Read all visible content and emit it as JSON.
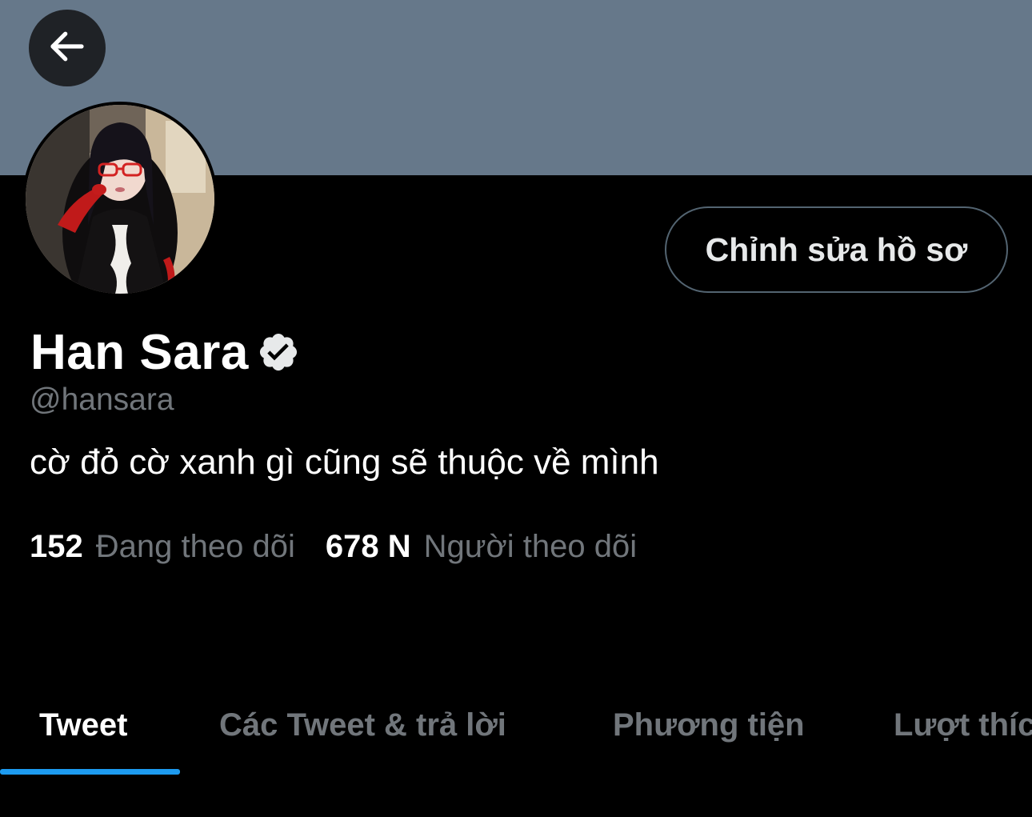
{
  "header": {
    "banner_color": "#66788a",
    "back_icon": "arrow-left-icon"
  },
  "profile": {
    "avatar_icon": "profile-photo",
    "edit_button_label": "Chỉnh sửa hồ sơ",
    "display_name": "Han Sara",
    "verified_icon": "verified-badge-icon",
    "handle": "@hansara",
    "bio": "cờ đỏ cờ xanh gì cũng sẽ thuộc về mình"
  },
  "stats": {
    "following_count": "152",
    "following_label": "Đang theo dõi",
    "followers_count": "678 N",
    "followers_label": "Người theo dõi"
  },
  "tabs": [
    {
      "label": "Tweet",
      "active": true
    },
    {
      "label": "Các Tweet & trả lời",
      "active": false
    },
    {
      "label": "Phương tiện",
      "active": false
    },
    {
      "label": "Lượt thích",
      "active": false
    }
  ],
  "colors": {
    "background": "#000000",
    "accent": "#1d9bf0",
    "muted_text": "#71767b",
    "border": "#536471"
  }
}
